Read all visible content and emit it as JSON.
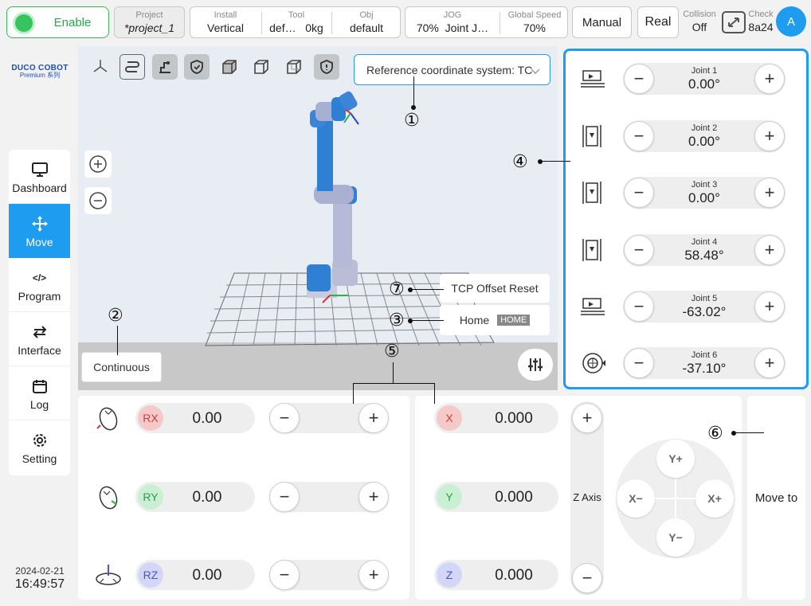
{
  "topbar": {
    "enable_label": "Enable",
    "project_title": "Project",
    "project_value": "*project_1",
    "install_title": "Install",
    "install_value": "Vertical",
    "tool_title": "Tool",
    "tool_value": "def…   0kg",
    "obj_title": "Obj",
    "obj_value": "default",
    "jog_title": "JOG",
    "jog_value": "70%  Joint J…",
    "speed_title": "Global Speed",
    "speed_value": "70%",
    "manual_label": "Manual",
    "real_label": "Real",
    "collision_title": "Collision",
    "collision_value": "Off",
    "check_title": "Check",
    "check_value": "8a24",
    "avatar_letter": "A"
  },
  "logo": {
    "line1": "DUCO COBOT",
    "line2": "Premium 系列"
  },
  "sidebar": {
    "items": [
      {
        "label": "Dashboard",
        "icon": "monitor-icon"
      },
      {
        "label": "Move",
        "icon": "move-arrows-icon"
      },
      {
        "label": "Program",
        "icon": "code-icon"
      },
      {
        "label": "Interface",
        "icon": "swap-arrows-icon"
      },
      {
        "label": "Log",
        "icon": "calendar-icon"
      },
      {
        "label": "Setting",
        "icon": "gear-icon"
      }
    ],
    "active": "Move"
  },
  "datetime": {
    "date": "2024-02-21",
    "time": "16:49:57"
  },
  "viewport": {
    "ref_coord_label": "Reference coordinate system: TC",
    "tcp_offset_reset_label": "TCP Offset Reset",
    "home_label": "Home",
    "home_tag": "HOME",
    "continuous_label": "Continuous"
  },
  "joints": [
    {
      "name": "Joint 1",
      "value": "0.00°"
    },
    {
      "name": "Joint 2",
      "value": "0.00°"
    },
    {
      "name": "Joint 3",
      "value": "0.00°"
    },
    {
      "name": "Joint 4",
      "value": "58.48°"
    },
    {
      "name": "Joint 5",
      "value": "-63.02°"
    },
    {
      "name": "Joint 6",
      "value": "-37.10°"
    }
  ],
  "rotation": [
    {
      "axis": "RX",
      "value": "0.00",
      "color": "#f6c9c9",
      "text_color": "#d33a3a"
    },
    {
      "axis": "RY",
      "value": "0.00",
      "color": "#c9f0d2",
      "text_color": "#2a9e4a"
    },
    {
      "axis": "RZ",
      "value": "0.00",
      "color": "#d3d6f6",
      "text_color": "#4a55c8"
    }
  ],
  "translation": [
    {
      "axis": "X",
      "value": "0.000",
      "color": "#f6c9c9",
      "text_color": "#d33a3a"
    },
    {
      "axis": "Y",
      "value": "0.000",
      "color": "#c9f0d2",
      "text_color": "#2a9e4a"
    },
    {
      "axis": "Z",
      "value": "0.000",
      "color": "#d3d6f6",
      "text_color": "#4a55c8"
    }
  ],
  "zaxis": {
    "label": "Z Axis",
    "plus": "+",
    "minus": "−"
  },
  "dpad": {
    "up": "Y+",
    "down": "Y−",
    "left": "X−",
    "right": "X+"
  },
  "move_to_label": "Move to",
  "common": {
    "plus": "+",
    "minus": "−"
  },
  "callouts": [
    "①",
    "②",
    "③",
    "④",
    "⑤",
    "⑥",
    "⑦"
  ],
  "colors": {
    "accent": "#1e9cf0",
    "enable_green": "#37c45e",
    "robot_blue": "#2f7fd4"
  }
}
